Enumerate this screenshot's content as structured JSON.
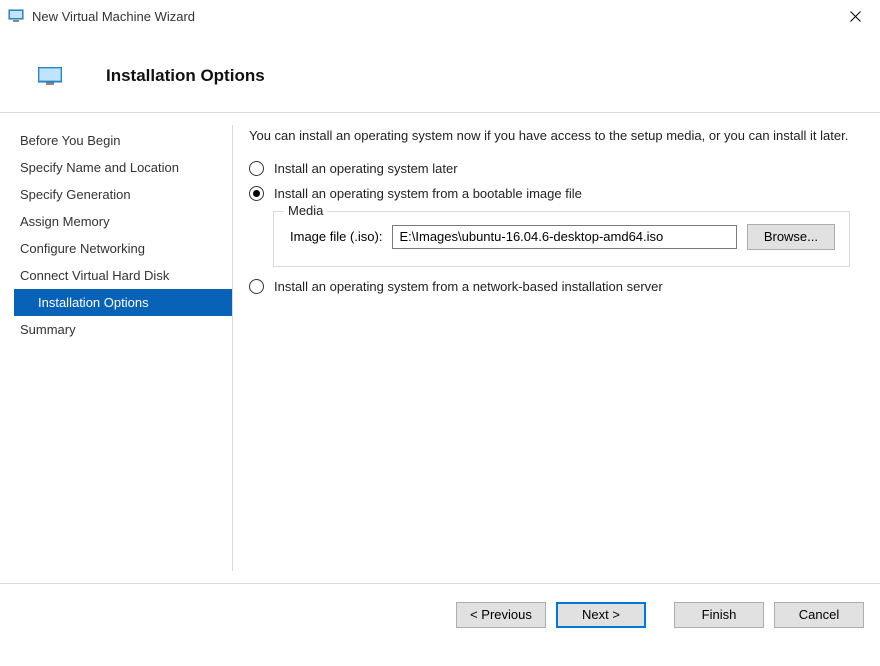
{
  "window": {
    "title": "New Virtual Machine Wizard"
  },
  "header": {
    "title": "Installation Options"
  },
  "nav": {
    "items": [
      {
        "label": "Before You Begin"
      },
      {
        "label": "Specify Name and Location"
      },
      {
        "label": "Specify Generation"
      },
      {
        "label": "Assign Memory"
      },
      {
        "label": "Configure Networking"
      },
      {
        "label": "Connect Virtual Hard Disk"
      },
      {
        "label": "Installation Options",
        "selected": true
      },
      {
        "label": "Summary"
      }
    ]
  },
  "main": {
    "intro": "You can install an operating system now if you have access to the setup media, or you can install it later.",
    "option_later": "Install an operating system later",
    "option_image": "Install an operating system from a bootable image file",
    "option_network": "Install an operating system from a network-based installation server",
    "media_legend": "Media",
    "image_file_label": "Image file (.iso):",
    "image_file_value": "E:\\Images\\ubuntu-16.04.6-desktop-amd64.iso",
    "browse_label": "Browse..."
  },
  "footer": {
    "previous": "< Previous",
    "next": "Next >",
    "finish": "Finish",
    "cancel": "Cancel"
  }
}
